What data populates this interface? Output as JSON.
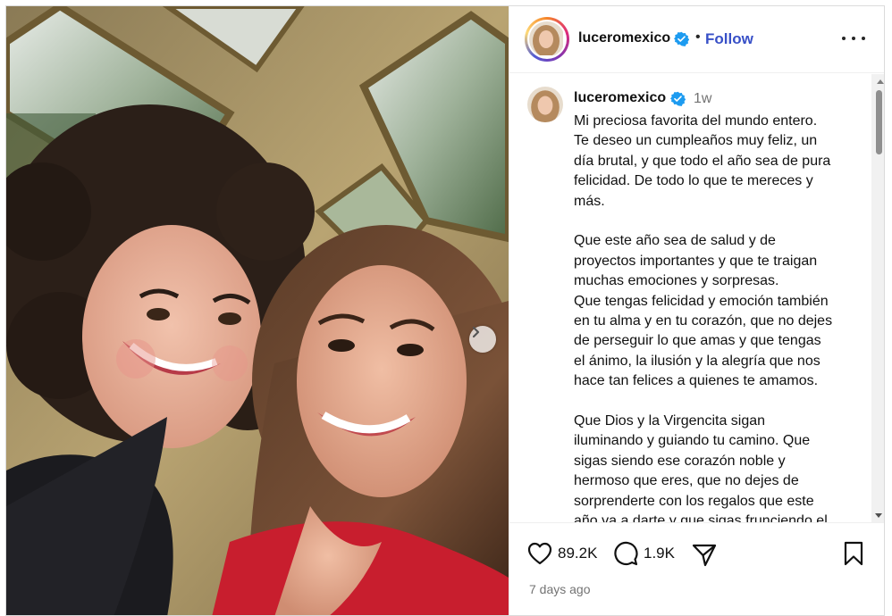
{
  "post": {
    "username": "luceromexico",
    "follow_label": "Follow",
    "time_short": "1w",
    "caption_lines": [
      "Mi preciosa favorita del mundo entero.",
      "Te deseo un cumpleaños muy feliz, un",
      "día brutal, y que todo el año sea de pura",
      "felicidad. De todo lo que te mereces y",
      "más.",
      "",
      "Que este año sea de salud y de",
      "proyectos importantes y que te traigan",
      "muchas emociones y sorpresas.",
      "Que tengas felicidad y emoción también",
      "en tu alma y en tu corazón, que no dejes",
      "de perseguir lo que amas y que tengas",
      "el ánimo, la ilusión y la alegría que nos",
      "hace tan felices a quienes te amamos.",
      "",
      "Que Dios y la Virgencita sigan",
      "iluminando y guiando tu camino. Que",
      "sigas siendo ese corazón noble y",
      "hermoso que eres, que no dejes de",
      "sorprenderte con los regalos que este",
      "año va a darte y que sigas frunciendo el"
    ],
    "likes": "89.2K",
    "comments": "1.9K",
    "posted_ago": "7 days ago"
  },
  "icons": {
    "verified": "verified-badge-icon",
    "more": "more-options-icon",
    "next": "chevron-right-icon",
    "like": "heart-icon",
    "comment": "comment-icon",
    "share": "paper-plane-icon",
    "save": "bookmark-icon"
  },
  "colors": {
    "follow": "#3850c7",
    "verified": "#1d9bf0",
    "muted": "#737373"
  }
}
